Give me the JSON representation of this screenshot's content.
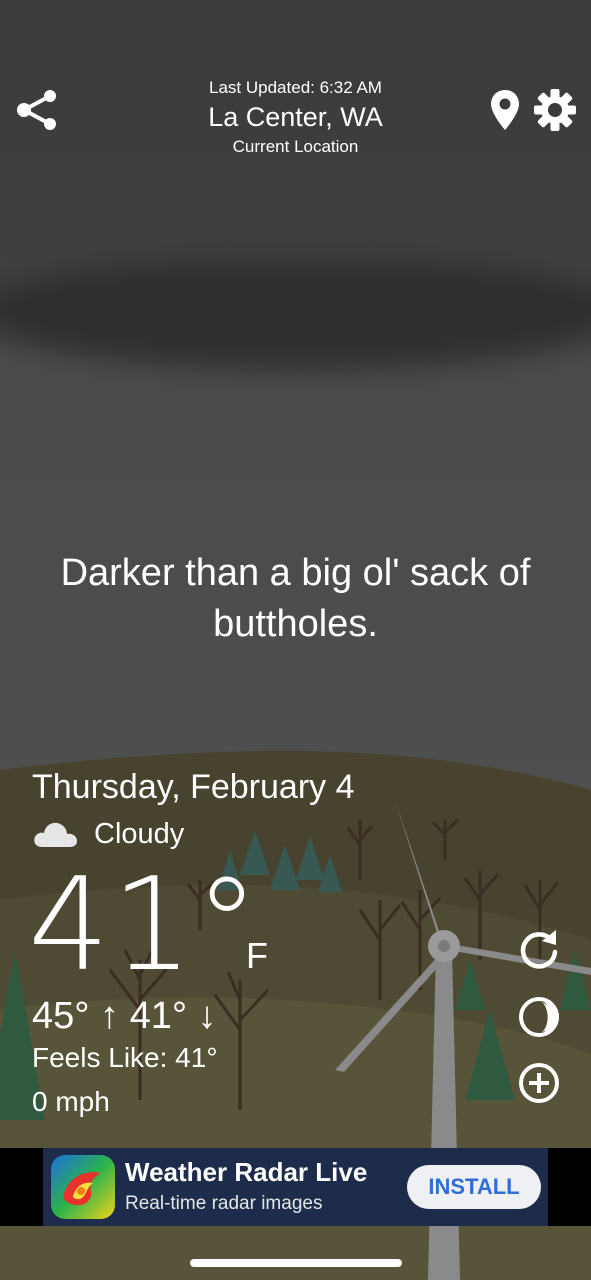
{
  "header": {
    "last_updated": "Last Updated: 6:32 AM",
    "city": "La Center, WA",
    "location_label": "Current Location"
  },
  "icons": {
    "share": "share-icon",
    "pin": "location-pin-icon",
    "settings": "gear-icon",
    "condition": "cloud-icon",
    "refresh": "refresh-icon",
    "moon": "moon-icon",
    "add": "plus-circle-icon"
  },
  "quote": "Darker than a big ol' sack of buttholes.",
  "weather": {
    "date": "Thursday, February 4",
    "condition": "Cloudy",
    "temp": "41°",
    "unit": "F",
    "hilo": "45° ↑ 41° ↓",
    "feels_like": "Feels Like: 41°",
    "wind": "0 mph"
  },
  "ad": {
    "title": "Weather Radar Live",
    "subtitle": "Real-time radar images",
    "button": "INSTALL"
  },
  "colors": {
    "sky": "#3f3f3f",
    "hill": "#4a4536",
    "tree": "#2f5a3f",
    "install_text": "#2d6fd6"
  }
}
